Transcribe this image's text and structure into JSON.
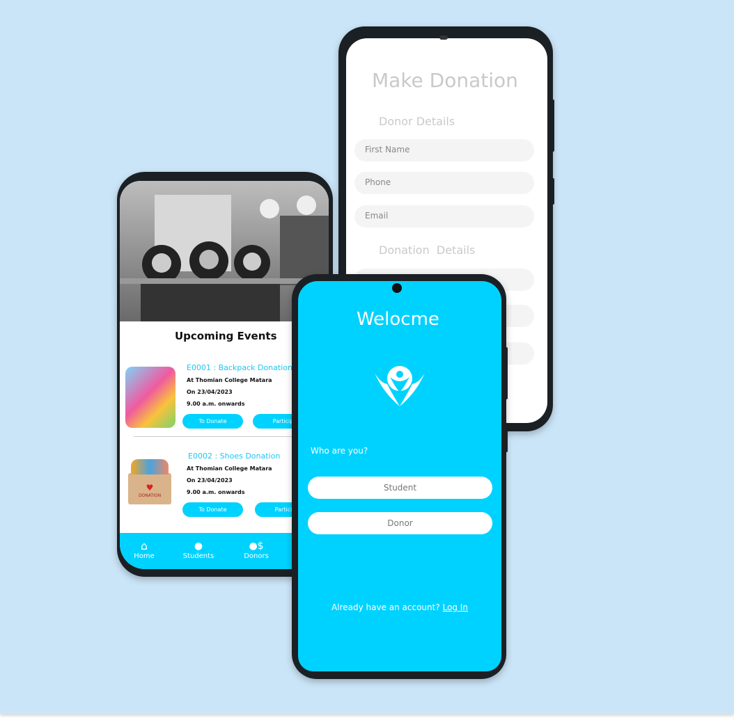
{
  "colors": {
    "background": "#cbe5f8",
    "accent": "#00d2ff",
    "phone_frame": "#1b2024"
  },
  "donation": {
    "title": "Make Donation",
    "donor_section": "Donor Details",
    "first_name_placeholder": "First Name",
    "phone_placeholder": "Phone",
    "email_placeholder": "Email",
    "donation_section": "Donation  Details"
  },
  "events": {
    "heading": "Upcoming Events",
    "items": [
      {
        "title": "E0001 : Backpack Donation",
        "location": "At Thomian College Matara",
        "date": "On 23/04/2023",
        "time": "9.00 a.m. onwards",
        "donate": "To Donate",
        "participate": "Particip"
      },
      {
        "title": "E0002 : Shoes Donation",
        "location": "At Thomian College Matara",
        "date": "On 23/04/2023",
        "time": "9.00 a.m. onwards",
        "donate": "To Donate",
        "participate": "Particip"
      }
    ],
    "nav": [
      {
        "label": "Home",
        "icon": "home-icon"
      },
      {
        "label": "Students",
        "icon": "student-icon"
      },
      {
        "label": "Donors",
        "icon": "donor-icon"
      }
    ],
    "donation_box_label": "DONATION"
  },
  "welcome": {
    "title": "Welocme",
    "question": "Who are you?",
    "student": "Student",
    "donor": "Donor",
    "account_prompt": "Already have an account?",
    "login": "Log In",
    "logo_icon": "hands-person-icon"
  }
}
